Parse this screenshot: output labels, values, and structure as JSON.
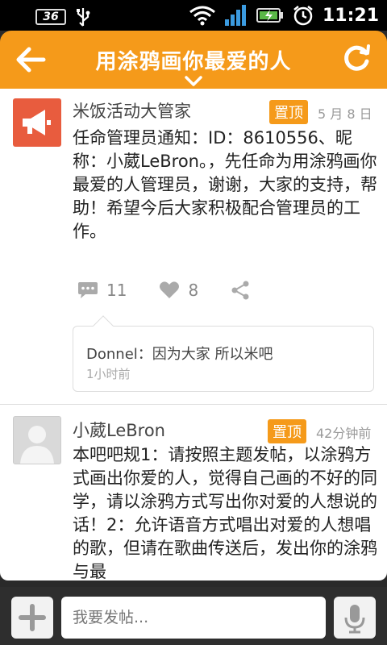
{
  "status_bar": {
    "battery_level": "36",
    "time": "11:21",
    "icons": [
      "usb-icon",
      "wifi-icon",
      "signal-icon",
      "battery-icon",
      "alarm-icon"
    ]
  },
  "header": {
    "title": "用涂鸦画你最爱的人",
    "color": "#f59a1a"
  },
  "posts": [
    {
      "author": "米饭活动大管家",
      "pin_label": "置顶",
      "time": "5 月 8 日",
      "body": "任命管理员通知：ID：8610556、昵称：小葳LeBron。，先任命为用涂鸦画你最爱的人管理员，谢谢，大家的支持，帮助！希望今后大家积极配合管理员的工作。",
      "comment_count": "11",
      "like_count": "8",
      "comment": {
        "text": "Donnel：因为大家 所以米吧",
        "time": "1小时前"
      }
    },
    {
      "author": "小葳LeBron",
      "pin_label": "置顶",
      "time": "42分钟前",
      "body": "本吧吧规1：请按照主题发帖，以涂鸦方式画出你爱的人，觉得自己画的不好的同学，请以涂鸦方式写出你对爱的人想说的话！2：允许语音方式唱出对爱的人想唱的歌，但请在歌曲传送后，发出你的涂鸦与最"
    }
  ],
  "compose": {
    "placeholder": "我要发帖..."
  }
}
